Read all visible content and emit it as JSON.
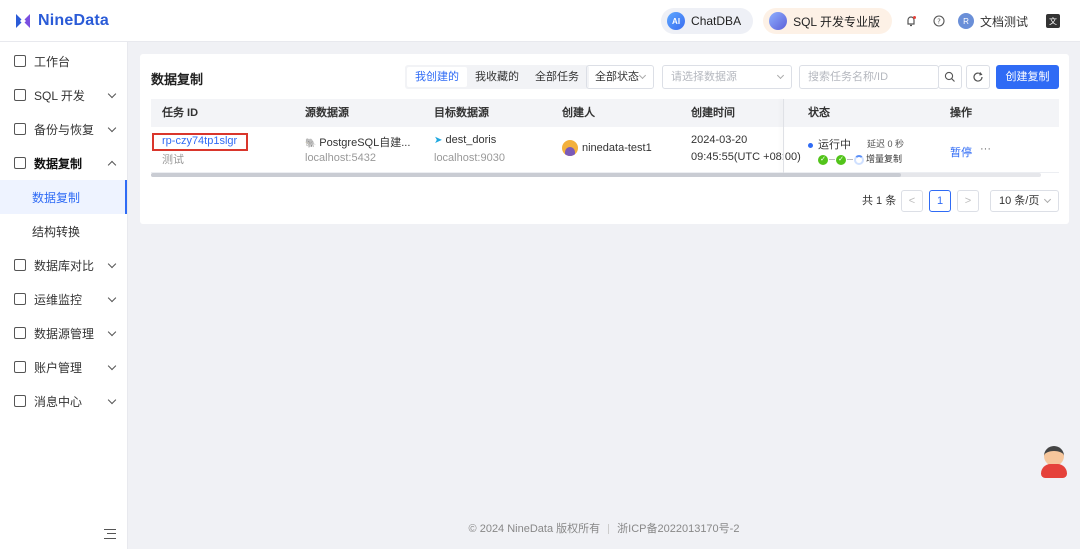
{
  "brand": {
    "name": "NineData"
  },
  "topbar": {
    "chatdba": {
      "badge": "AI",
      "label": "ChatDBA"
    },
    "sql_pro": {
      "label": "SQL 开发专业版"
    },
    "user_name": "文档测试",
    "user_initial": "R"
  },
  "sidebar": {
    "items": [
      {
        "label": "工作台",
        "icon": "home-icon"
      },
      {
        "label": "SQL 开发",
        "icon": "sql-icon"
      },
      {
        "label": "备份与恢复",
        "icon": "backup-icon"
      },
      {
        "label": "数据复制",
        "icon": "replication-icon"
      },
      {
        "label": "数据复制"
      },
      {
        "label": "结构转换"
      },
      {
        "label": "数据库对比",
        "icon": "compare-icon"
      },
      {
        "label": "运维监控",
        "icon": "monitor-icon"
      },
      {
        "label": "数据源管理",
        "icon": "datasource-icon"
      },
      {
        "label": "账户管理",
        "icon": "account-icon"
      },
      {
        "label": "消息中心",
        "icon": "message-icon"
      }
    ]
  },
  "main": {
    "title": "数据复制",
    "tabs": [
      "我创建的",
      "我收藏的",
      "全部任务"
    ],
    "status_filter": "全部状态",
    "datasource_placeholder": "请选择数据源",
    "search_placeholder": "搜索任务名称/ID",
    "create_button": "创建复制",
    "table": {
      "headers": [
        "任务 ID",
        "源数据源",
        "目标数据源",
        "创建人",
        "创建时间",
        "状态",
        "操作"
      ],
      "rows": [
        {
          "id": "rp-czy74tp1slgr",
          "name": "测试",
          "source": "PostgreSQL自建...",
          "source_host": "localhost:5432",
          "target": "dest_doris",
          "target_host": "localhost:9030",
          "creator": "ninedata-test1",
          "created_date": "2024-03-20",
          "created_time": "09:45:55(UTC +08:00)",
          "status": "运行中",
          "delay": "延迟 0 秒",
          "phase": "增量复制",
          "action": "暂停",
          "more": "···"
        }
      ]
    },
    "pagination": {
      "total": "共 1 条",
      "current_page": "1",
      "page_size": "10 条/页"
    }
  },
  "footer": {
    "copyright": "© 2024 NineData 版权所有",
    "icp": "浙ICP备2022013170号-2"
  }
}
